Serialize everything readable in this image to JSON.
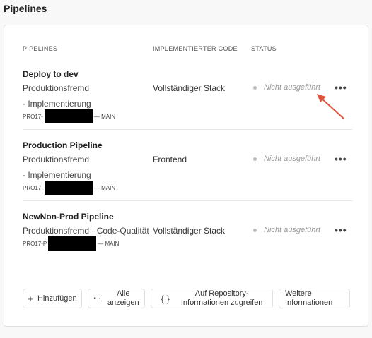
{
  "page_title": "Pipelines",
  "headers": {
    "pipelines": "PIPELINES",
    "code": "IMPLEMENTIERTER CODE",
    "status": "STATUS"
  },
  "rows": [
    {
      "name": "Deploy to dev",
      "type": "Produktionsfremd",
      "kind": "· Implementierung",
      "repo_prefix": "PRO17-",
      "branch": "— MAIN",
      "code": "Vollständiger Stack",
      "status": "Nicht ausgeführt",
      "more": "•••"
    },
    {
      "name": "Production Pipeline",
      "type": "Produktionsfremd",
      "kind": "· Implementierung",
      "repo_prefix": "PRO17-",
      "branch": "— MAIN",
      "code": "Frontend",
      "status": "Nicht ausgeführt",
      "more": "•••"
    },
    {
      "name": "NewNon-Prod Pipeline",
      "type": "Produktionsfremd · Code-Qualität",
      "repo_prefix": "PRO17-P",
      "branch": "— MAIN",
      "code": "Vollständiger Stack",
      "status": "Nicht ausgeführt",
      "more": "•••"
    }
  ],
  "buttons": {
    "add": "Hinzufügen",
    "show_all_1": "Alle",
    "show_all_2": "anzeigen",
    "repo_1": "Auf Repository-",
    "repo_2": "Informationen zugreifen",
    "info_1": "Weitere",
    "info_2": "Informationen"
  },
  "annotation_color": "#e0533c"
}
